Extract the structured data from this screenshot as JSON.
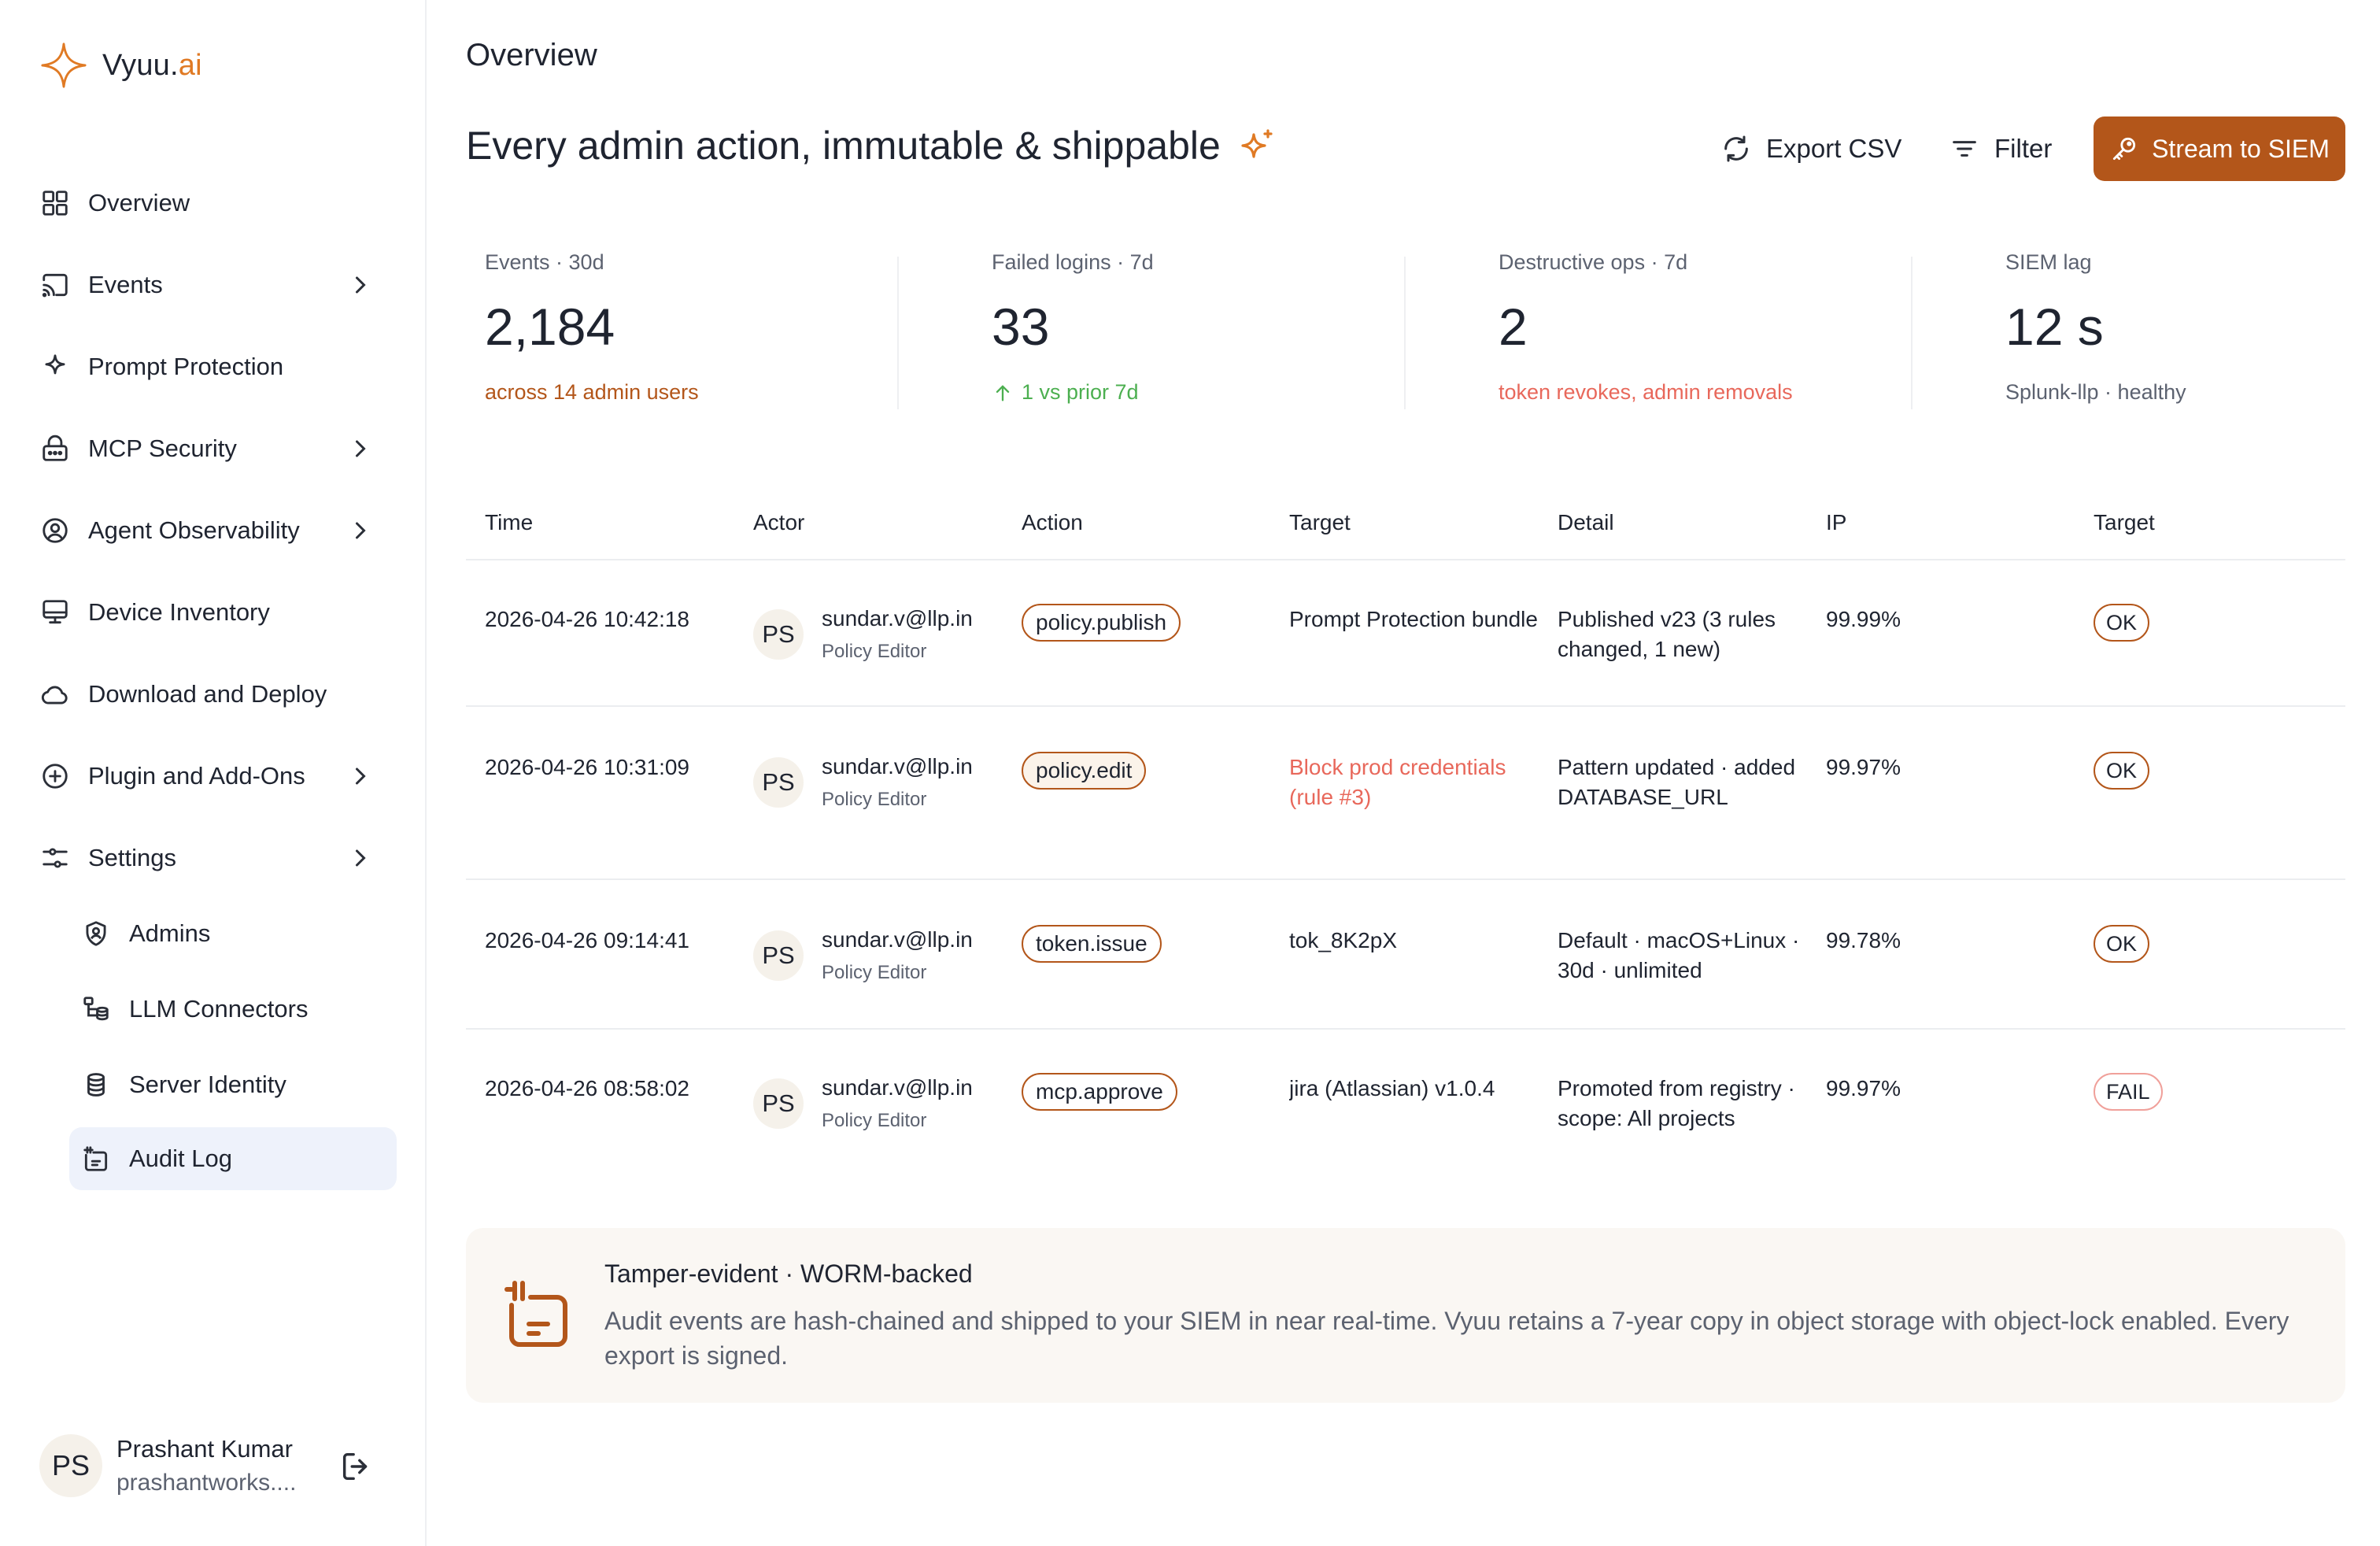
{
  "brand": {
    "name": "Vyuu.",
    "name_accent": "ai",
    "accent_color": "#e07a24",
    "logo_icon": "sparkle-star-icon"
  },
  "sidebar": {
    "items": [
      {
        "label": "Overview",
        "icon": "grid-icon"
      },
      {
        "label": "Events",
        "icon": "cast-icon"
      },
      {
        "label": "Prompt Protection",
        "icon": "sparkle-icon"
      },
      {
        "label": "MCP Security",
        "icon": "lock-icon"
      },
      {
        "label": "Agent Observability",
        "icon": "user-circle-icon"
      },
      {
        "label": "Device Inventory",
        "icon": "monitor-icon"
      },
      {
        "label": "Download and Deploy",
        "icon": "cloud-icon"
      },
      {
        "label": "Plugin and Add-Ons",
        "icon": "plus-circle-icon"
      },
      {
        "label": "Settings",
        "icon": "sliders-icon"
      }
    ],
    "sub_items": [
      {
        "label": "Admins",
        "icon": "shield-user-icon"
      },
      {
        "label": "LLM Connectors",
        "icon": "connector-icon"
      },
      {
        "label": "Server Identity",
        "icon": "database-icon"
      },
      {
        "label": "Audit Log",
        "icon": "audit-log-icon",
        "active": true
      }
    ],
    "user": {
      "initials": "PS",
      "name": "Prashant Kumar",
      "email": "prashantworks...."
    }
  },
  "header": {
    "page_title": "Overview",
    "hero_title": "Every admin action, immutable & shippable",
    "export_label": "Export CSV",
    "filter_label": "Filter",
    "stream_label": "Stream to SIEM",
    "primary_color": "#b3561a"
  },
  "stats": [
    {
      "label": "Events · 30d",
      "value": "2,184",
      "sub": "across 14 admin users",
      "sub_color": "#b3561a"
    },
    {
      "label": "Failed logins · 7d",
      "value": "33",
      "sub": "1 vs prior 7d",
      "sub_color": "#4caf50"
    },
    {
      "label": "Destructive ops · 7d",
      "value": "2",
      "sub": "token revokes, admin removals",
      "sub_color": "#e8685b"
    },
    {
      "label": "SIEM lag",
      "value": "12 s",
      "sub": "Splunk-llp · healthy",
      "sub_color": "#5c6270"
    }
  ],
  "table": {
    "columns": [
      "Time",
      "Actor",
      "Action",
      "Target",
      "Detail",
      "IP",
      "Target"
    ],
    "rows": [
      {
        "time": "2026-04-26 10:42:18",
        "initials": "PS",
        "email": "sundar.v@llp.in",
        "role": "Policy Editor",
        "action": "policy.publish",
        "target": "Prompt Protection bundle",
        "detail": "Published v23 (3 rules changed, 1 new)",
        "ip": "99.99%",
        "status": "OK"
      },
      {
        "time": "2026-04-26 10:31:09",
        "initials": "PS",
        "email": "sundar.v@llp.in",
        "role": "Policy Editor",
        "action": "policy.edit",
        "target": "Block prod credentials (rule #3)",
        "detail": "Pattern updated · added DATABASE_URL",
        "ip": "99.97%",
        "status": "OK"
      },
      {
        "time": "2026-04-26 09:14:41",
        "initials": "PS",
        "email": "sundar.v@llp.in",
        "role": "Policy Editor",
        "action": "token.issue",
        "target": "tok_8K2pX",
        "detail": "Default · macOS+Linux · 30d · unlimited",
        "ip": "99.78%",
        "status": "OK"
      },
      {
        "time": "2026-04-26 08:58:02",
        "initials": "PS",
        "email": "sundar.v@llp.in",
        "role": "Policy Editor",
        "action": "mcp.approve",
        "target": "jira (Atlassian) v1.0.4",
        "detail": "Promoted from registry · scope: All projects",
        "ip": "99.97%",
        "status": "FAIL"
      }
    ]
  },
  "info_card": {
    "title": "Tamper-evident · WORM-backed",
    "body": "Audit events are hash-chained and shipped to your SIEM in near real-time. Vyuu retains a 7-year copy in object storage with object-lock enabled. Every export is signed.",
    "icon": "audit-log-icon"
  }
}
